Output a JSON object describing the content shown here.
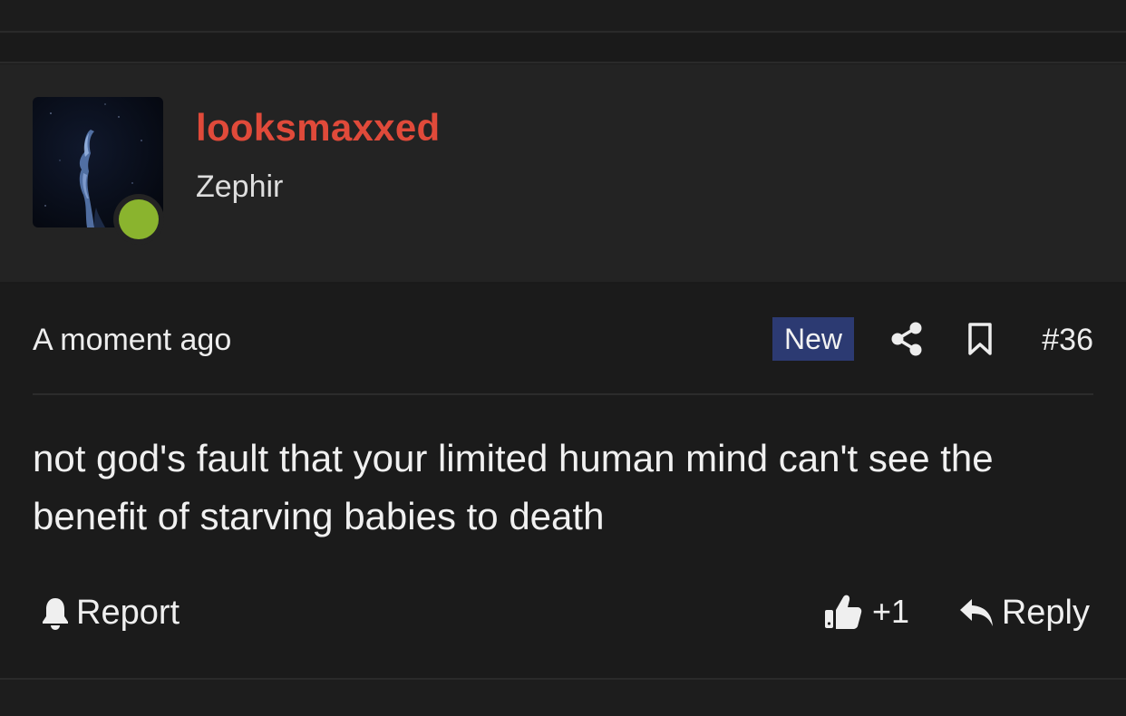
{
  "post": {
    "author": {
      "username": "looksmaxxed",
      "title": "Zephir",
      "username_color": "#e04a3a",
      "status": "online",
      "status_color": "#8ab42e"
    },
    "date": "A moment ago",
    "new_badge": "New",
    "badge_color": "#2c3a72",
    "number": "#36",
    "message": "not god's fault that your limited human mind can't see the benefit of starving babies to death",
    "actions": {
      "report_label": "Report",
      "like_count": "+1",
      "reply_label": "Reply"
    },
    "icons": {
      "share": "share-icon",
      "bookmark": "bookmark-icon",
      "report": "bell-icon",
      "like": "thumbs-up-icon",
      "reply": "reply-arrow-icon"
    }
  }
}
